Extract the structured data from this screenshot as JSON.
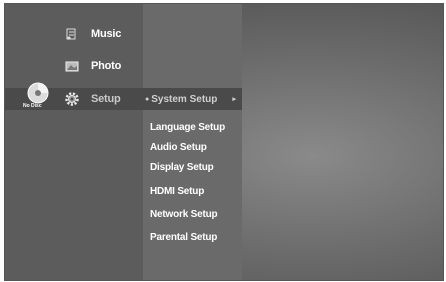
{
  "main_menu": {
    "items": [
      {
        "label": "Music",
        "icon": "music-note-icon"
      },
      {
        "label": "Photo",
        "icon": "photo-icon"
      },
      {
        "label": "Setup",
        "icon": "gear-icon"
      }
    ]
  },
  "disc": {
    "status": "No Disc",
    "icon": "disc-icon"
  },
  "setup_menu": {
    "selected": "System Setup",
    "items": [
      {
        "label": "Language Setup"
      },
      {
        "label": "Audio Setup"
      },
      {
        "label": "Display Setup"
      },
      {
        "label": "HDMI Setup"
      },
      {
        "label": "Network Setup"
      },
      {
        "label": "Parental Setup"
      }
    ]
  },
  "colors": {
    "text": "#ffffff",
    "panel_left": "#5c5c5c",
    "panel_mid": "#6a6a6a",
    "highlight": "#4a4a4a"
  }
}
